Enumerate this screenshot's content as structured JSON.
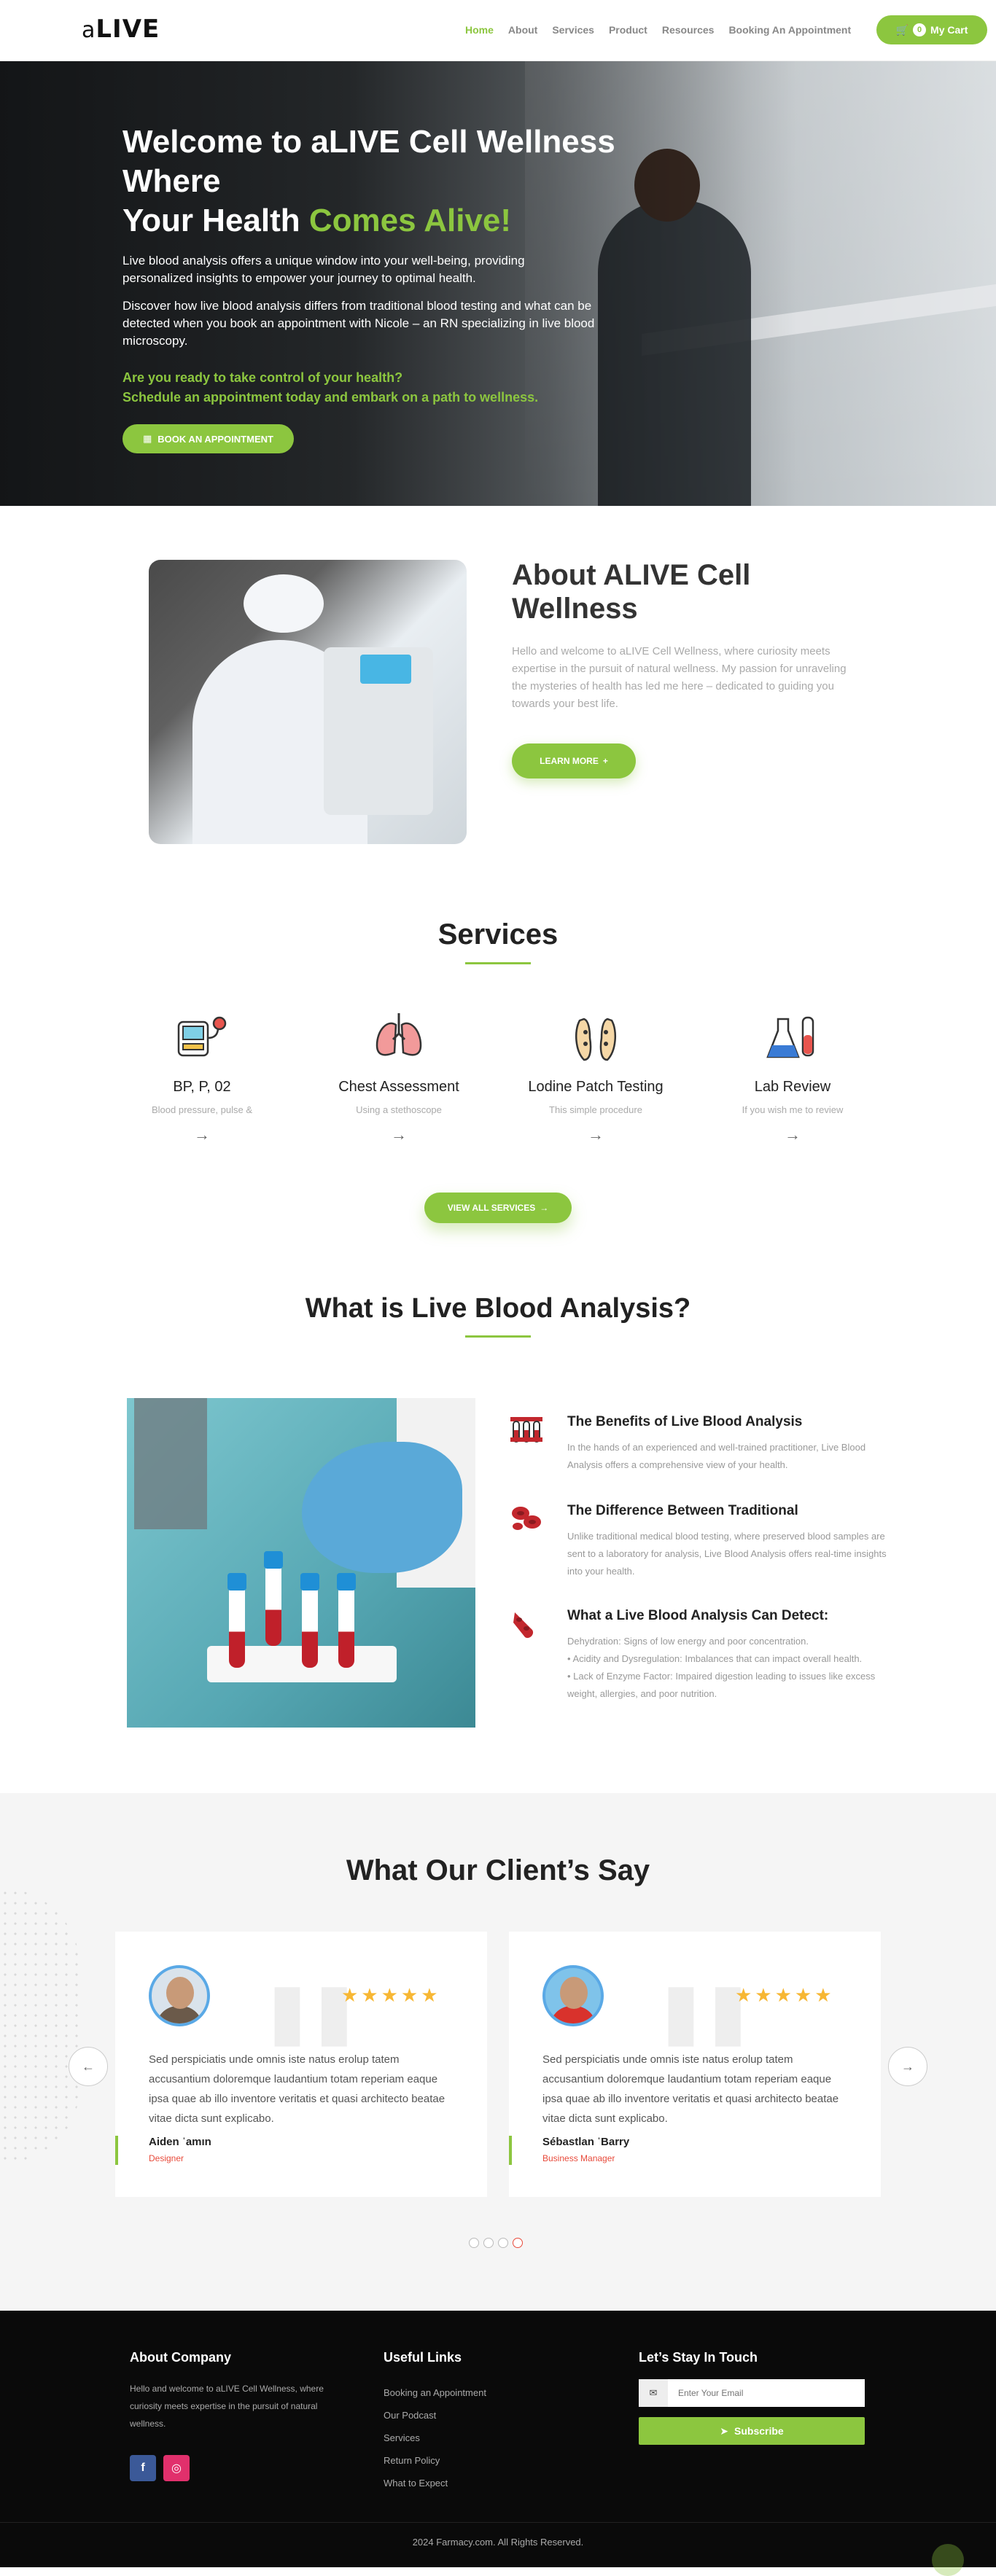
{
  "header": {
    "logo_prefix": "a",
    "logo_main": "LIVE",
    "nav": [
      "Home",
      "About",
      "Services",
      "Product",
      "Resources",
      "Booking An Appointment"
    ],
    "cart_count": "0",
    "cart_label": "My Cart"
  },
  "hero": {
    "title_line1": "Welcome to aLIVE Cell Wellness Where",
    "title_line2_a": "Your Health ",
    "title_line2_b": "Comes Alive!",
    "para1": "Live blood analysis offers a unique window into your well-being, providing personalized insights to empower your journey to optimal health.",
    "para2": "Discover how live blood analysis differs from traditional blood testing and what can be detected when you book an appointment with Nicole – an RN specializing in live blood microscopy.",
    "ready": "Are you ready to take control of your health?",
    "schedule": "Schedule an appointment today and embark on a path to wellness.",
    "button": "BOOK AN APPOINTMENT"
  },
  "about": {
    "title": "About ALIVE Cell Wellness",
    "text": "Hello and welcome to aLIVE Cell Wellness, where curiosity meets expertise in the pursuit of natural wellness. My passion for unraveling the mysteries of health has led me here – dedicated to guiding you towards your best life.",
    "button": "LEARN MORE"
  },
  "services": {
    "title": "Services",
    "items": [
      {
        "title": "BP, P, 02",
        "subtitle": "Blood pressure, pulse &",
        "icon": "bp-monitor-icon"
      },
      {
        "title": "Chest Assessment",
        "subtitle": "Using a stethoscope",
        "icon": "lungs-icon"
      },
      {
        "title": "Lodine Patch Testing",
        "subtitle": "This simple procedure",
        "icon": "feet-icon"
      },
      {
        "title": "Lab Review",
        "subtitle": "If you wish me to review",
        "icon": "flasks-icon"
      }
    ],
    "button": "VIEW ALL SERVICES"
  },
  "analysis": {
    "title": "What is Live Blood Analysis?",
    "items": [
      {
        "title": "The Benefits of Live Blood Analysis",
        "text": "In the hands of an experienced and well-trained practitioner, Live Blood Analysis offers a comprehensive view of your health."
      },
      {
        "title": "The Difference Between Traditional",
        "text": "Unlike traditional medical blood testing, where preserved blood samples are sent to a laboratory for analysis, Live Blood Analysis offers real-time insights into your health."
      },
      {
        "title": "What a Live Blood Analysis Can Detect:",
        "text": "Dehydration: Signs of low energy and poor concentration.\n• Acidity and Dysregulation: Imbalances that can impact overall health.\n• Lack of Enzyme Factor: Impaired digestion leading to issues like excess weight, allergies, and poor nutrition."
      }
    ]
  },
  "testimonials": {
    "title": "What Our Client’s Say",
    "items": [
      {
        "text": "Sed perspiciatis unde omnis iste natus erolup tatem accusantium doloremque laudantium totam reperiam eaque ipsa quae ab illo inventore veritatis et quasi architecto beatae vitae dicta sunt explicabo.",
        "name": "Aiden ˈamın",
        "role": "Designer",
        "stars": "★★★★★"
      },
      {
        "text": "Sed perspiciatis unde omnis iste natus erolup tatem accusantium doloremque laudantium totam reperiam eaque ipsa quae ab illo inventore veritatis et quasi architecto beatae vitae dicta sunt explicabo.",
        "name": "Sébastlan ˈBarry",
        "role": "Business Manager",
        "stars": "★★★★★"
      }
    ]
  },
  "footer": {
    "about_title": "About Company",
    "about_text": "Hello and welcome to aLIVE Cell Wellness, where curiosity meets expertise in the pursuit of natural wellness.",
    "links_title": "Useful Links",
    "links": [
      "Booking an Appointment",
      "Our Podcast",
      "Services",
      "Return Policy",
      "What to Expect"
    ],
    "touch_title": "Let’s Stay In Touch",
    "email_placeholder": "Enter Your Email",
    "subscribe": "Subscribe",
    "copyright": "2024 Farmacy.com. All Rights Reserved."
  },
  "colors": {
    "accent": "#8cc63f",
    "red": "#e84a3a",
    "footer": "#0a0a0a"
  }
}
